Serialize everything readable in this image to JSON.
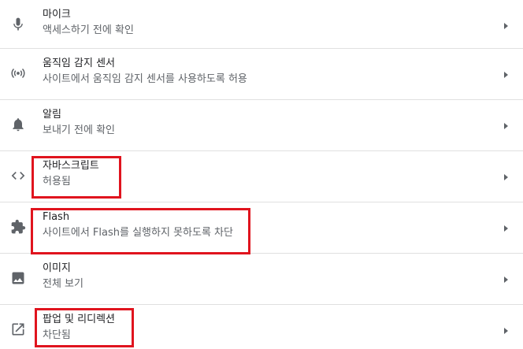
{
  "settings": {
    "items": [
      {
        "title": "마이크",
        "subtitle": "액세스하기 전에 확인",
        "icon": "microphone-icon"
      },
      {
        "title": "움직임 감지 센서",
        "subtitle": "사이트에서 움직임 감지 센서를 사용하도록 허용",
        "icon": "motion-sensor-icon"
      },
      {
        "title": "알림",
        "subtitle": "보내기 전에 확인",
        "icon": "bell-icon"
      },
      {
        "title": "자바스크립트",
        "subtitle": "허용됨",
        "icon": "code-icon"
      },
      {
        "title": "Flash",
        "subtitle": "사이트에서 Flash를 실행하지 못하도록 차단",
        "icon": "puzzle-icon"
      },
      {
        "title": "이미지",
        "subtitle": "전체 보기",
        "icon": "image-icon"
      },
      {
        "title": "팝업 및 리디렉션",
        "subtitle": "차단됨",
        "icon": "open-in-new-icon"
      }
    ]
  },
  "colors": {
    "icon": "#5f6368",
    "arrow": "#5f6368",
    "highlight": "#e0141e",
    "divider": "#e0e0e0"
  }
}
